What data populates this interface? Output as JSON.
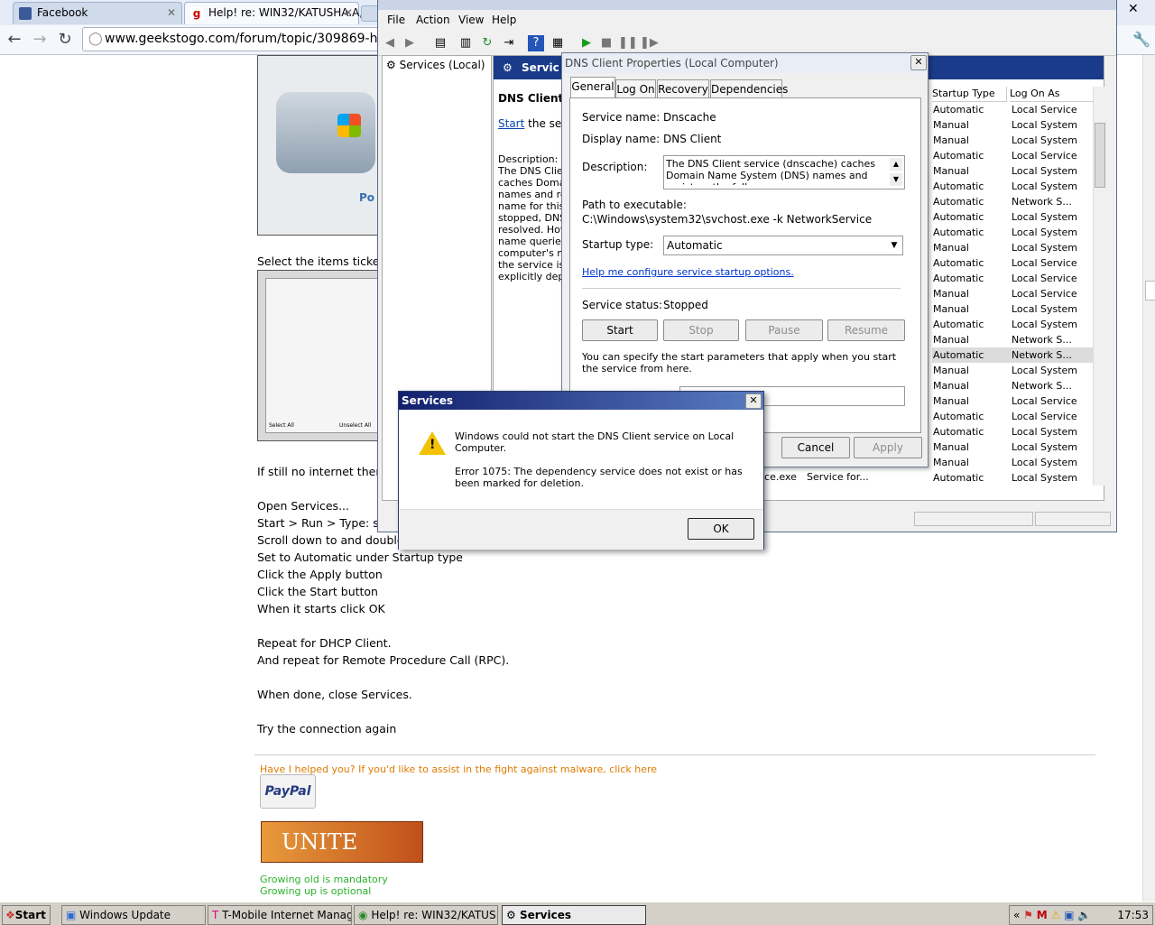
{
  "browser": {
    "tabs": [
      {
        "label": "Facebook"
      },
      {
        "label": "Help! re: WIN32/KATUSHA.A,"
      }
    ],
    "url": "www.geekstogo.com/forum/topic/309869-help-re"
  },
  "article": {
    "select_items_text": "Select the items ticked",
    "image_caption": "Po",
    "image_buttons": [
      "Select All",
      "Unselect All"
    ],
    "lines": [
      "If still no internet then d",
      "Open Services...",
      "Start > Run > Type: se",
      "Scroll down to and double c",
      "Set to Automatic under Startup type",
      "Click the Apply button",
      "Click the Start button",
      "When it starts click OK",
      "Repeat for DHCP Client.",
      "And repeat for Remote Procedure Call (RPC).",
      "When done, close Services.",
      "Try the connection again"
    ],
    "helped_link": "Have I helped you? If you'd like to assist in the fight against malware, click here",
    "paypal": "PayPal",
    "unite": "UNITE",
    "sig1": "Growing old is mandatory",
    "sig2": "Growing up is optional"
  },
  "services_window": {
    "title": "Services",
    "menu": [
      "File",
      "Action",
      "View",
      "Help"
    ],
    "tree_item": "Services (Local)",
    "detail_header": "Servic",
    "service_name": "DNS Client",
    "start_link": "Start",
    "start_suffix": " the servi",
    "description_label": "Description:",
    "description_lines": [
      "The DNS Client",
      "caches Domain",
      "names and reg",
      "name for this c",
      "stopped, DNS",
      "resolved. How",
      "name queries v",
      "computer's nar",
      "the service is c",
      "explicitly depe"
    ],
    "col_startup": "Startup Type",
    "col_logon": "Log On As",
    "rows": [
      [
        "Automatic",
        "Local Service"
      ],
      [
        "Manual",
        "Local System"
      ],
      [
        "Manual",
        "Local System"
      ],
      [
        "Automatic",
        "Local Service"
      ],
      [
        "Manual",
        "Local System"
      ],
      [
        "Automatic",
        "Local System"
      ],
      [
        "Automatic",
        "Network S..."
      ],
      [
        "Automatic",
        "Local System"
      ],
      [
        "Automatic",
        "Local System"
      ],
      [
        "Manual",
        "Local System"
      ],
      [
        "Automatic",
        "Local Service"
      ],
      [
        "Automatic",
        "Local Service"
      ],
      [
        "Manual",
        "Local Service"
      ],
      [
        "Manual",
        "Local System"
      ],
      [
        "Automatic",
        "Local System"
      ],
      [
        "Manual",
        "Network S..."
      ],
      [
        "Automatic",
        "Network S..."
      ],
      [
        "Manual",
        "Local System"
      ],
      [
        "Manual",
        "Network S..."
      ],
      [
        "Manual",
        "Local Service"
      ],
      [
        "Automatic",
        "Local Service"
      ],
      [
        "Automatic",
        "Local System"
      ],
      [
        "Manual",
        "Local System"
      ],
      [
        "Manual",
        "Local System"
      ],
      [
        "Automatic",
        "Local System"
      ]
    ],
    "partial_row": [
      "ice.exe",
      "Service for..."
    ]
  },
  "properties": {
    "title": "DNS Client Properties (Local Computer)",
    "tabs": [
      "General",
      "Log On",
      "Recovery",
      "Dependencies"
    ],
    "service_name_label": "Service name:",
    "service_name_value": "Dnscache",
    "display_name_label": "Display name:",
    "display_name_value": "DNS Client",
    "description_label": "Description:",
    "description_value": "The DNS Client service (dnscache) caches Domain Name System (DNS) names and registers the full",
    "path_label": "Path to executable:",
    "path_value": "C:\\Windows\\system32\\svchost.exe -k NetworkService",
    "startup_label": "Startup type:",
    "startup_value": "Automatic",
    "help_link": "Help me configure service startup options.",
    "status_label": "Service status:",
    "status_value": "Stopped",
    "btn_start": "Start",
    "btn_stop": "Stop",
    "btn_pause": "Pause",
    "btn_resume": "Resume",
    "params_text": "You can specify the start parameters that apply when you start the service from here.",
    "btn_cancel": "Cancel",
    "btn_apply": "Apply"
  },
  "error": {
    "title": "Services",
    "message": "Windows could not start the DNS Client service on Local Computer.",
    "detail": "Error 1075: The dependency service does not exist or has been marked for deletion.",
    "ok": "OK"
  },
  "taskbar": {
    "start": "Start",
    "items": [
      "Windows Update",
      "T-Mobile Internet Manager",
      "Help! re: WIN32/KATUS...",
      "Services"
    ],
    "clock": "17:53"
  }
}
